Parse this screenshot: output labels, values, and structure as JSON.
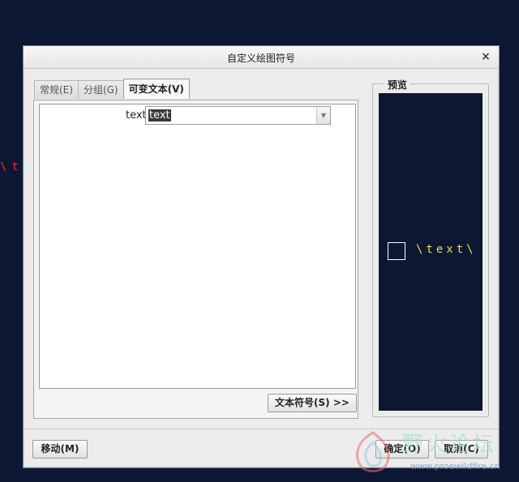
{
  "background": {
    "canvas_text": "\\text"
  },
  "dialog": {
    "title": "自定义绘图符号",
    "close_glyph": "×",
    "tabs": [
      {
        "label": "常规(E)",
        "active": false
      },
      {
        "label": "分组(G)",
        "active": false
      },
      {
        "label": "可变文本(V)",
        "active": true
      }
    ],
    "variable_text": {
      "label": "text",
      "value": "text",
      "dropdown_arrow": "▼"
    },
    "text_symbol_button": "文本符号(S) >>",
    "preview": {
      "legend": "预览",
      "rendered_text": "\\text\\"
    },
    "buttons": {
      "move": "移动(M)",
      "ok": "确定(O)",
      "cancel": "取消(C)"
    }
  },
  "watermark": {
    "text": "野火论坛",
    "url": "www.proewildfire.cn"
  },
  "colors": {
    "canvas_bg": "#0c1733",
    "canvas_text": "#ff2a2a",
    "preview_text": "#f3df3a",
    "dialog_bg": "#ececec"
  }
}
